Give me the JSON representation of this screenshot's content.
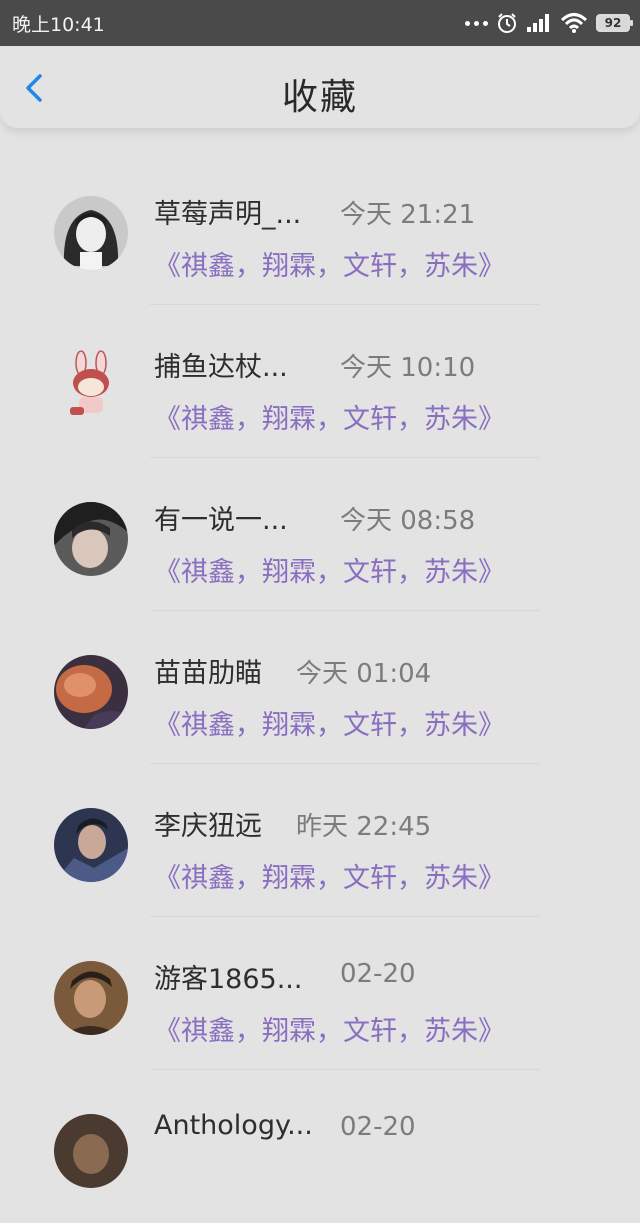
{
  "status_bar": {
    "time": "晚上10:41",
    "battery": "92",
    "icons": [
      "more-dots-icon",
      "alarm-icon",
      "signal-icon",
      "wifi-icon",
      "battery-icon"
    ]
  },
  "header": {
    "title": "收藏",
    "back_icon": "chevron-left-icon"
  },
  "colors": {
    "accent": "#1e88e5",
    "link_purple": "#8a6fc0",
    "background": "#e3e3e3"
  },
  "favorites": [
    {
      "user": "草莓声明_...",
      "time": "今天 21:21",
      "title": "《祺鑫，翔霖，文轩，苏朱》",
      "avatar": "anime-girl"
    },
    {
      "user": "捕鱼达杖...",
      "time": "今天 10:10",
      "title": "《祺鑫，翔霖，文轩，苏朱》",
      "avatar": "bunny"
    },
    {
      "user": "有一说一...",
      "time": "今天 08:58",
      "title": "《祺鑫，翔霖，文轩，苏朱》",
      "avatar": "photo"
    },
    {
      "user": "苗苗肋瞄",
      "time": "今天 01:04",
      "title": "《祺鑫，翔霖，文轩，苏朱》",
      "avatar": "orange"
    },
    {
      "user": "李庆狃远",
      "time": "昨天 22:45",
      "title": "《祺鑫，翔霖，文轩，苏朱》",
      "avatar": "photo-blue"
    },
    {
      "user": "游客1865...",
      "time": "02-20",
      "title": "《祺鑫，翔霖，文轩，苏朱》",
      "avatar": "photo-warm"
    },
    {
      "user": "Anthology...",
      "time": "02-20",
      "title": "",
      "avatar": "photo-dark"
    }
  ]
}
